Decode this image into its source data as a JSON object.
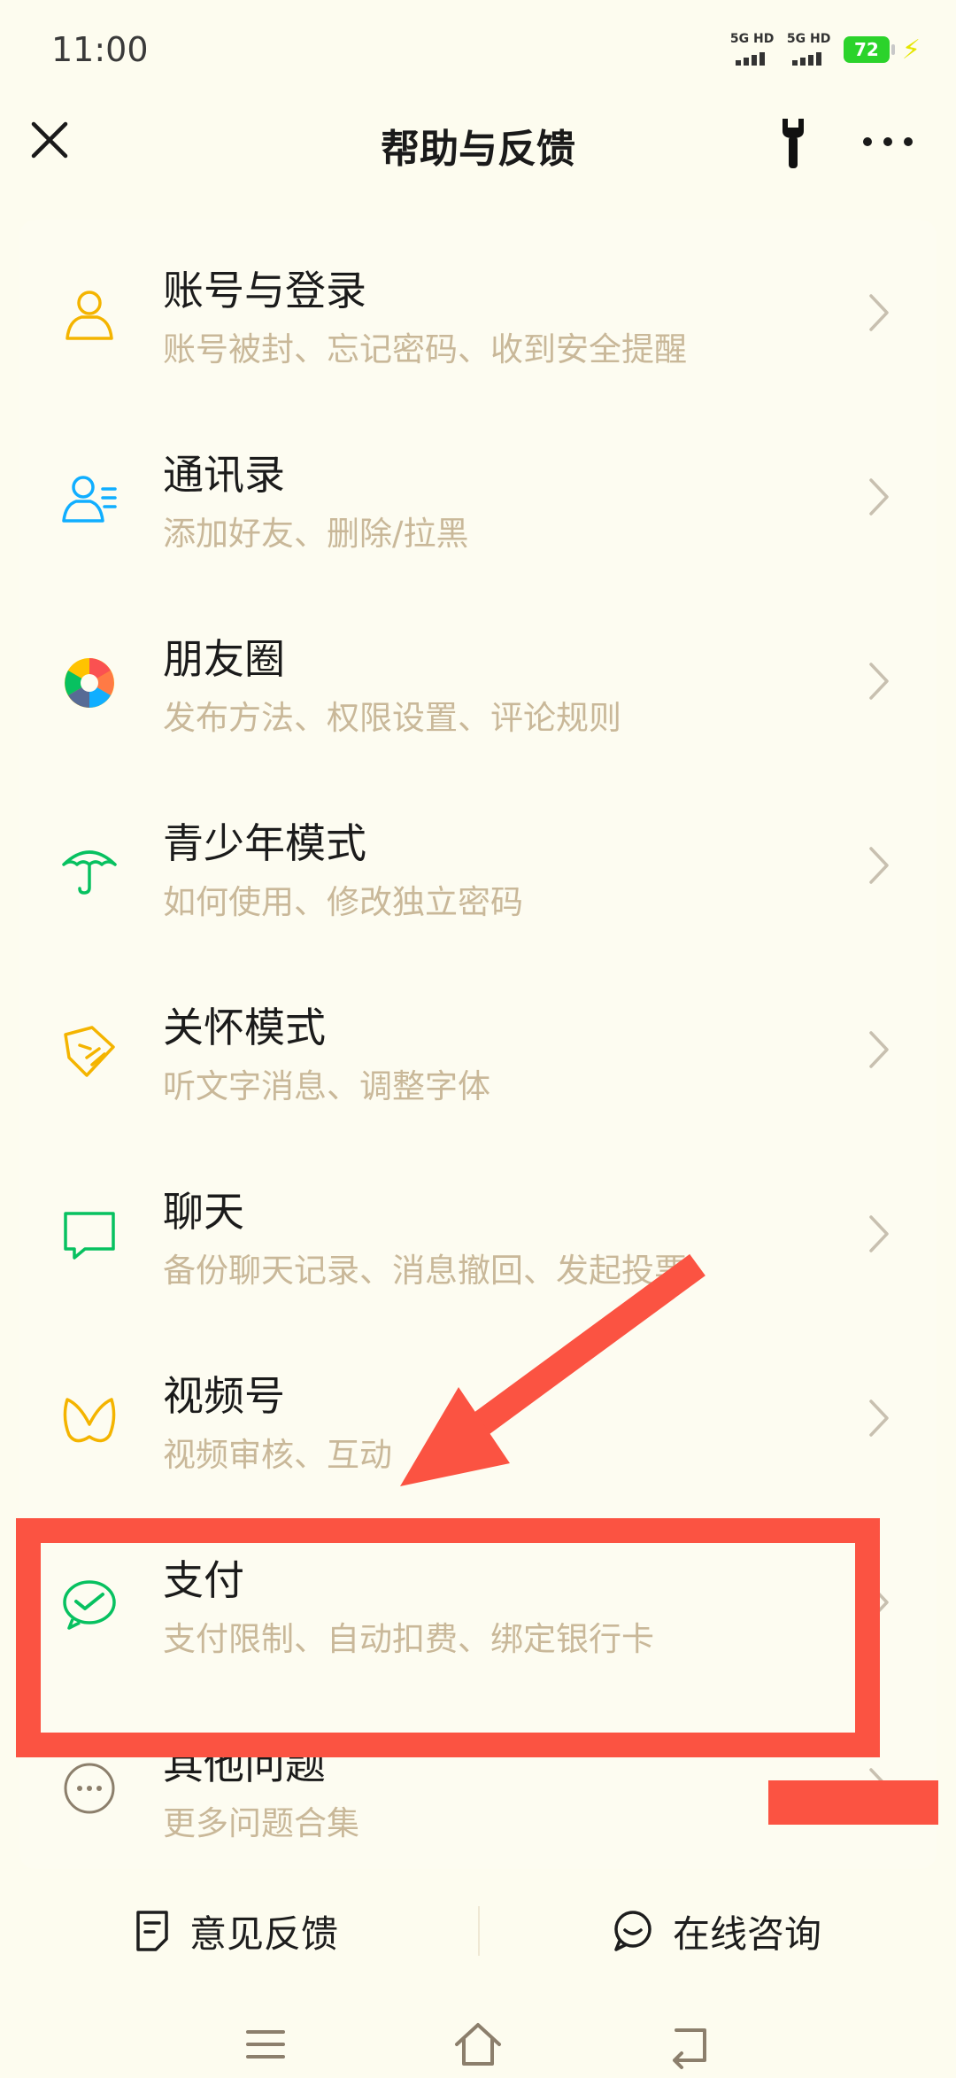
{
  "status_bar": {
    "time": "11:00",
    "signal_1": "5G HD",
    "signal_2": "5G HD",
    "battery": "72"
  },
  "nav": {
    "title": "帮助与反馈",
    "close_icon": "close-icon",
    "tool_icon": "wrench-icon",
    "more_icon": "more-icon"
  },
  "menu": {
    "items": [
      {
        "title": "账号与登录",
        "subtitle": "账号被封、忘记密码、收到安全提醒",
        "icon": "account-icon"
      },
      {
        "title": "通讯录",
        "subtitle": "添加好友、删除/拉黑",
        "icon": "contacts-icon"
      },
      {
        "title": "朋友圈",
        "subtitle": "发布方法、权限设置、评论规则",
        "icon": "moments-icon"
      },
      {
        "title": "青少年模式",
        "subtitle": "如何使用、修改独立密码",
        "icon": "umbrella-icon"
      },
      {
        "title": "关怀模式",
        "subtitle": "听文字消息、调整字体",
        "icon": "care-icon"
      },
      {
        "title": "聊天",
        "subtitle": "备份聊天记录、消息撤回、发起投票",
        "icon": "chat-icon"
      },
      {
        "title": "视频号",
        "subtitle": "视频审核、互动",
        "icon": "channels-icon"
      },
      {
        "title": "支付",
        "subtitle": "支付限制、自动扣费、绑定银行卡",
        "icon": "pay-icon"
      },
      {
        "title": "其他问题",
        "subtitle": "更多问题合集",
        "icon": "more-questions-icon"
      }
    ]
  },
  "bottom": {
    "feedback_label": "意见反馈",
    "consult_label": "在线咨询"
  },
  "colors": {
    "background": "#fdfcef",
    "subtitle": "#c9b899",
    "annotation": "#fb5342",
    "wechat_green": "#1aad19"
  }
}
